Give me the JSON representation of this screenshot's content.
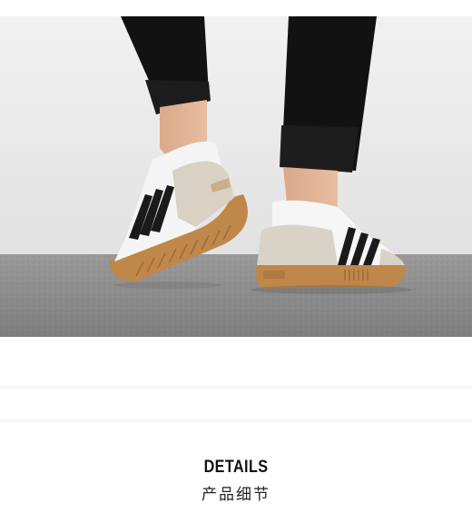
{
  "photo": {
    "subject": "sneakers-on-feet",
    "colors": {
      "wall": "#e9e9e9",
      "floor": "#8f8f8f",
      "pants": "#111111",
      "shoe_upper": "#f4f4f4",
      "suede": "#d9d2c6",
      "stripes": "#1a1a1a",
      "gum_sole": "#c0874a"
    }
  },
  "details": {
    "title": "DETAILS",
    "subtitle": "产品细节"
  }
}
